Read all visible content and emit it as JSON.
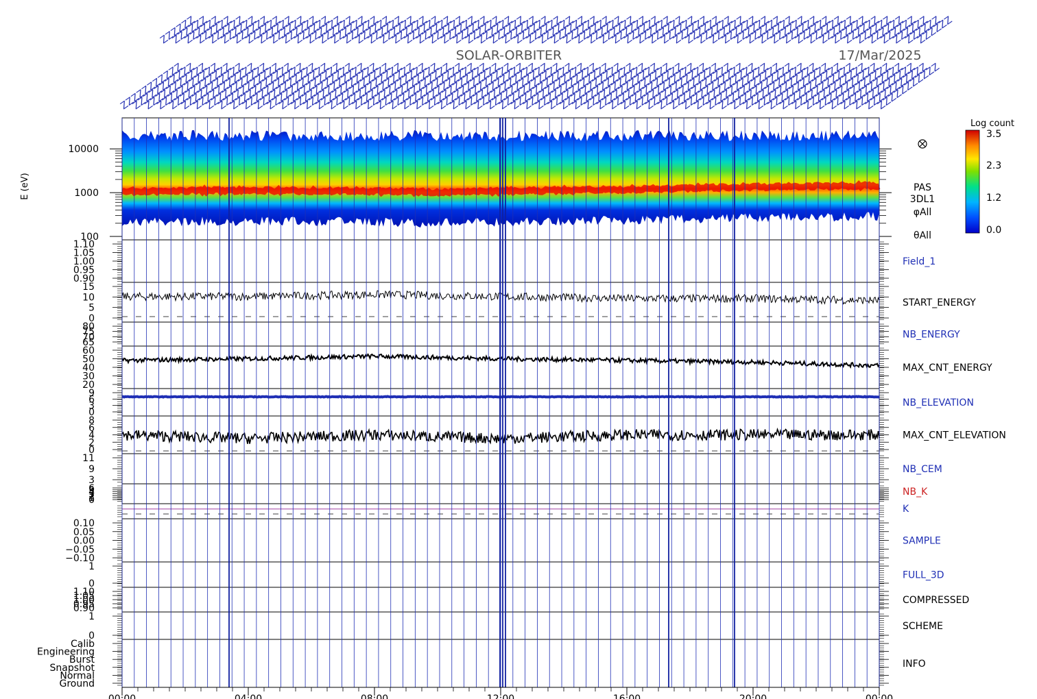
{
  "header": {
    "mission": "SOLAR-ORBITER",
    "date": "17/Mar/2025"
  },
  "colorbar": {
    "title": "Log count",
    "ticks": [
      "3.5",
      "2.3",
      "1.2",
      "0.0"
    ]
  },
  "spectrogram": {
    "ylabel": "E (eV)",
    "yticks": [
      "10000",
      "1000",
      "100"
    ],
    "side_labels": [
      "PAS",
      "3DL1",
      "φAll",
      "θAll"
    ]
  },
  "x_ticks": [
    "00:00",
    "04:00",
    "08:00",
    "12:00",
    "16:00",
    "20:00",
    "00:00"
  ],
  "panels": [
    {
      "name": "Field_1",
      "color": "#1f2fb5",
      "ticks": [
        "1.10",
        "1.05",
        "1.00",
        "0.95",
        "0.90"
      ]
    },
    {
      "name": "START_ENERGY",
      "color": "#000000",
      "ticks": [
        "15",
        "10",
        "5",
        "0"
      ]
    },
    {
      "name": "NB_ENERGY",
      "color": "#1f2fb5",
      "ticks": [
        "80",
        "75",
        "70",
        "65"
      ]
    },
    {
      "name": "MAX_CNT_ENERGY",
      "color": "#000000",
      "ticks": [
        "60",
        "50",
        "40",
        "30",
        "20"
      ]
    },
    {
      "name": "NB_ELEVATION",
      "color": "#1f2fb5",
      "ticks": [
        "9",
        "6",
        "3",
        "0"
      ]
    },
    {
      "name": "MAX_CNT_ELEVATION",
      "color": "#000000",
      "ticks": [
        "8",
        "6",
        "4",
        "2",
        "0"
      ]
    },
    {
      "name": "NB_CEM",
      "color": "#1f2fb5",
      "ticks": [
        "11",
        "9",
        "3"
      ]
    },
    {
      "name": "NB_K",
      "color": "#cc2222",
      "ticks": [
        "6",
        "5",
        "4",
        "3",
        "2",
        "1",
        "0"
      ]
    },
    {
      "name": "K",
      "color": "#1f2fb5",
      "ticks": []
    },
    {
      "name": "SAMPLE",
      "color": "#1f2fb5",
      "ticks": [
        "0.10",
        "0.05",
        "0.00",
        "−0.05",
        "−0.10"
      ]
    },
    {
      "name": "FULL_3D",
      "color": "#1f2fb5",
      "ticks": [
        "1",
        "0"
      ]
    },
    {
      "name": "COMPRESSED",
      "color": "#000000",
      "ticks": [
        "1.10",
        "1.05",
        "1.00",
        "0.95",
        "0.90"
      ]
    },
    {
      "name": "SCHEME",
      "color": "#000000",
      "ticks": [
        "1",
        "0"
      ]
    },
    {
      "name": "INFO",
      "color": "#000000",
      "ticks": [
        "Calib",
        "Engineering",
        "Burst",
        "Snapshot",
        "Normal",
        "Ground"
      ]
    }
  ],
  "chart_data": {
    "type": "heatmap",
    "title": "SOLAR-ORBITER 17/Mar/2025",
    "xlabel": "",
    "ylabel": "E (eV)",
    "x_range": [
      "00:00",
      "24:00"
    ],
    "ylim": [
      100,
      20000
    ],
    "y_scale": "log",
    "color_scale": {
      "label": "Log count",
      "range": [
        0.0,
        3.5
      ]
    },
    "peak_energy_eV": [
      {
        "t": "00:00",
        "E": 1000
      },
      {
        "t": "04:00",
        "E": 1050
      },
      {
        "t": "08:00",
        "E": 1000
      },
      {
        "t": "10:00",
        "E": 950
      },
      {
        "t": "12:00",
        "E": 1000
      },
      {
        "t": "16:00",
        "E": 1100
      },
      {
        "t": "20:00",
        "E": 1250
      },
      {
        "t": "24:00",
        "E": 1350
      }
    ],
    "series": [
      {
        "name": "START_ENERGY",
        "values": [
          10,
          10,
          11,
          10,
          9,
          9,
          8
        ]
      },
      {
        "name": "MAX_CNT_ENERGY",
        "values": [
          48,
          50,
          53,
          50,
          48,
          46,
          42
        ]
      },
      {
        "name": "NB_ELEVATION",
        "values": [
          9,
          9,
          9,
          9,
          9,
          9,
          9
        ]
      },
      {
        "name": "MAX_CNT_ELEVATION",
        "values": [
          4,
          3,
          4,
          3,
          4,
          4,
          4
        ]
      },
      {
        "name": "K",
        "values": [
          1,
          1,
          1,
          1,
          1,
          1,
          1
        ]
      }
    ],
    "series_x": [
      "00:00",
      "04:00",
      "08:00",
      "12:00",
      "16:00",
      "20:00",
      "24:00"
    ]
  }
}
